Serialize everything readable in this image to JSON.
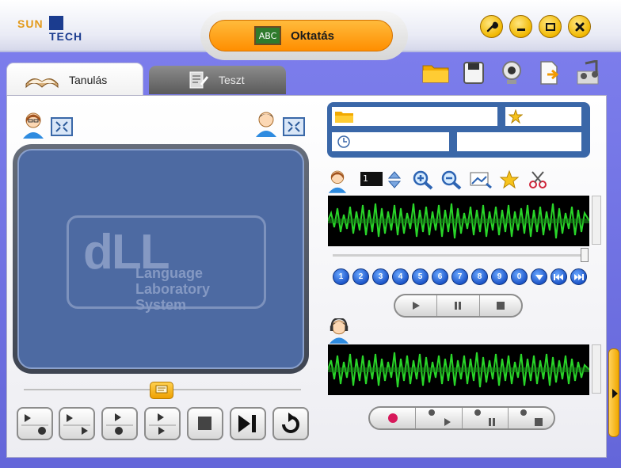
{
  "logo": {
    "line1": "SUN",
    "line2": "TECH"
  },
  "mode": {
    "title": "Oktatás",
    "board_text": "ABC"
  },
  "tabs": [
    {
      "label": "Tanulás",
      "active": true
    },
    {
      "label": "Teszt",
      "active": false
    }
  ],
  "window_buttons": [
    "wrench-icon",
    "minimize-icon",
    "maximize-icon",
    "close-icon"
  ],
  "toolbar": [
    "folder-icon",
    "save-icon",
    "webcam-icon",
    "export-icon",
    "music-icon"
  ],
  "video": {
    "logo_letters": "dLL",
    "logo_line1": "Language",
    "logo_line2": "Laboratory System"
  },
  "track": {
    "counter": "1"
  },
  "number_buttons": [
    "1",
    "2",
    "3",
    "4",
    "5",
    "6",
    "7",
    "8",
    "9",
    "0"
  ],
  "colors": {
    "accent_orange": "#ff9a10",
    "panel_blue": "#3a67a8",
    "wave_green": "#22dd22",
    "background": "#7375e4"
  }
}
